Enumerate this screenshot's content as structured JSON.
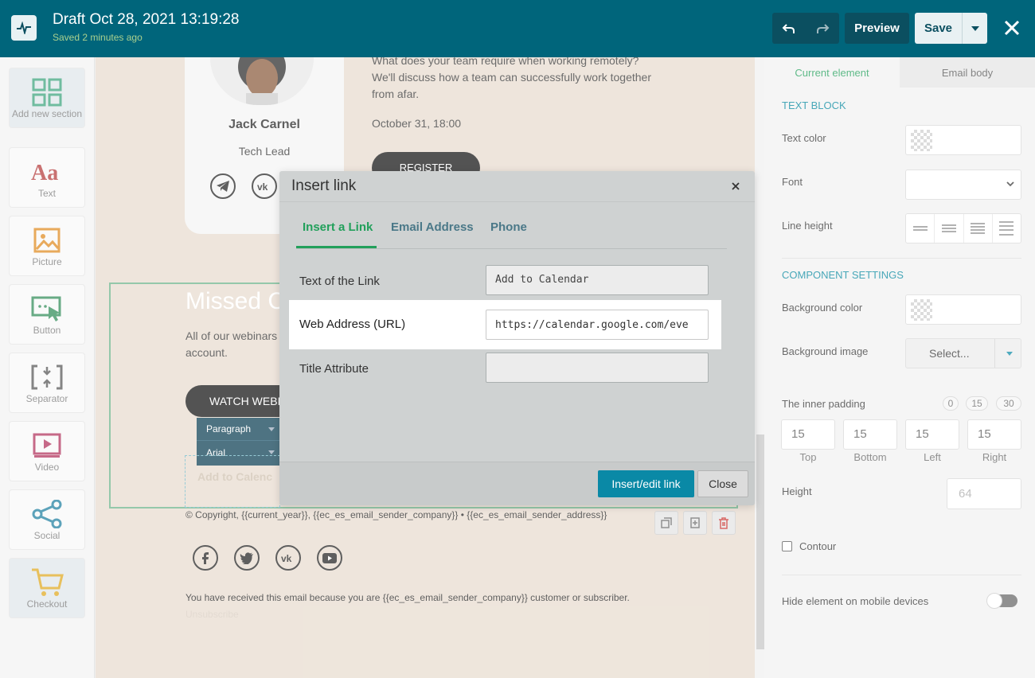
{
  "header": {
    "title": "Draft Oct 28, 2021 13:19:28",
    "subtitle": "Saved 2 minutes ago",
    "preview_label": "Preview",
    "save_label": "Save"
  },
  "sidebar": {
    "items": [
      {
        "label": "Add new section",
        "icon": "grid-icon",
        "color": "#3aa37a"
      },
      {
        "label": "Text",
        "icon": "text-icon",
        "color": "#b53b3b"
      },
      {
        "label": "Picture",
        "icon": "picture-icon",
        "color": "#e08a1e"
      },
      {
        "label": "Button",
        "icon": "button-icon",
        "color": "#2e8b57"
      },
      {
        "label": "Separator",
        "icon": "separator-icon",
        "color": "#555555"
      },
      {
        "label": "Video",
        "icon": "video-icon",
        "color": "#b0305a"
      },
      {
        "label": "Social",
        "icon": "social-icon",
        "color": "#1e7fa0"
      },
      {
        "label": "Checkout",
        "icon": "cart-icon",
        "color": "#e0a81e"
      }
    ]
  },
  "canvas": {
    "speaker_name": "Jack Carnel",
    "speaker_role": "Tech Lead",
    "event_text": "What does your team require when working remotely? We'll discuss how a team can successfully work together from afar.",
    "event_date": "October 31, 18:00",
    "register_label": "REGISTER",
    "missed_heading": "Missed C",
    "webinar_text": "All of our webinars",
    "webinar_text_2": "account.",
    "watch_label": "WATCH WEBI",
    "format_paragraph": "Paragraph",
    "format_font": "Arial",
    "add_calendar_text": "Add to Calenc",
    "copyright": "© Copyright, {{current_year}}, {{ec_es_email_sender_company}} • {{ec_es_email_sender_address}}",
    "received_text": "You have received this email because you are {{ec_es_email_sender_company}} customer or subscriber.",
    "unsubscribe": "Unsubscribe"
  },
  "right_panel": {
    "tabs": [
      "Current element",
      "Email body"
    ],
    "text_block_heading": "TEXT BLOCK",
    "text_color_label": "Text color",
    "font_label": "Font",
    "line_height_label": "Line height",
    "component_heading": "COMPONENT SETTINGS",
    "bg_color_label": "Background color",
    "bg_image_label": "Background image",
    "select_label": "Select...",
    "inner_padding_label": "The inner padding",
    "padding_presets": [
      "0",
      "15",
      "30"
    ],
    "padding": [
      {
        "value": "15",
        "label": "Top"
      },
      {
        "value": "15",
        "label": "Bottom"
      },
      {
        "value": "15",
        "label": "Left"
      },
      {
        "value": "15",
        "label": "Right"
      }
    ],
    "height_label": "Height",
    "height_value": "64",
    "contour_label": "Contour",
    "hide_mobile_label": "Hide element on mobile devices"
  },
  "modal": {
    "title": "Insert link",
    "tabs": [
      "Insert a Link",
      "Email Address",
      "Phone"
    ],
    "text_label": "Text of the Link",
    "text_value": "Add to Calendar",
    "url_label": "Web Address (URL)",
    "url_value": "https://calendar.google.com/eve",
    "title_attr_label": "Title Attribute",
    "title_attr_value": "",
    "insert_label": "Insert/edit link",
    "close_label": "Close"
  },
  "colors": {
    "topbar": "#00657b",
    "accent_green": "#22a05b",
    "accent_teal": "#0a89a6"
  }
}
